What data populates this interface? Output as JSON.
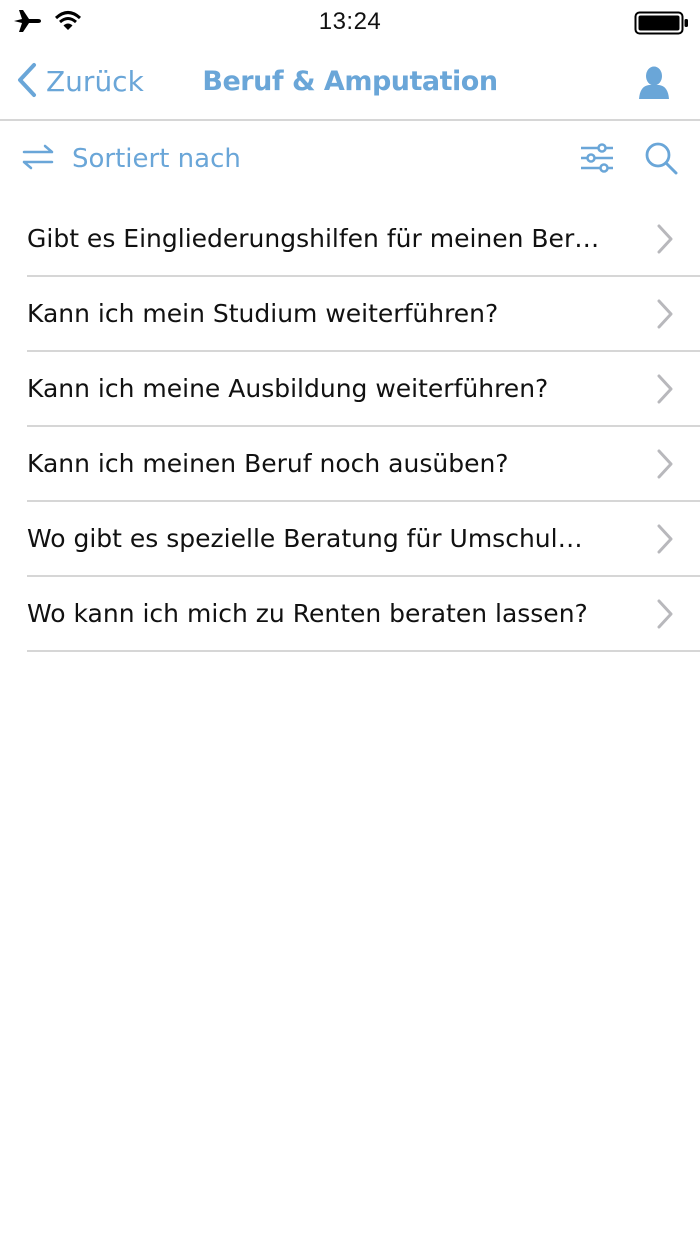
{
  "status_bar": {
    "time": "13:24",
    "icons": [
      "airplane-icon",
      "wifi-icon",
      "battery-icon"
    ]
  },
  "nav": {
    "back_label": "Zurück",
    "title": "Beruf & Amputation",
    "icons": [
      "chevron-left-icon",
      "user-icon"
    ]
  },
  "toolbar": {
    "sort_label": "Sortiert nach",
    "icons": [
      "swap-arrows-icon",
      "sliders-icon",
      "search-icon"
    ]
  },
  "questions": [
    {
      "text": "Gibt es Eingliederungshilfen für meinen Ber…"
    },
    {
      "text": "Kann ich mein Studium weiterführen?"
    },
    {
      "text": "Kann ich meine Ausbildung weiterführen?"
    },
    {
      "text": "Kann ich meinen Beruf noch ausüben?"
    },
    {
      "text": "Wo gibt es spezielle Beratung für Umschul…"
    },
    {
      "text": "Wo kann ich mich zu Renten beraten lassen?"
    }
  ],
  "colors": {
    "accent": "#6aa6d8",
    "separator": "#d6d6d6",
    "chevron": "#b8b8bc",
    "text": "#111111"
  }
}
